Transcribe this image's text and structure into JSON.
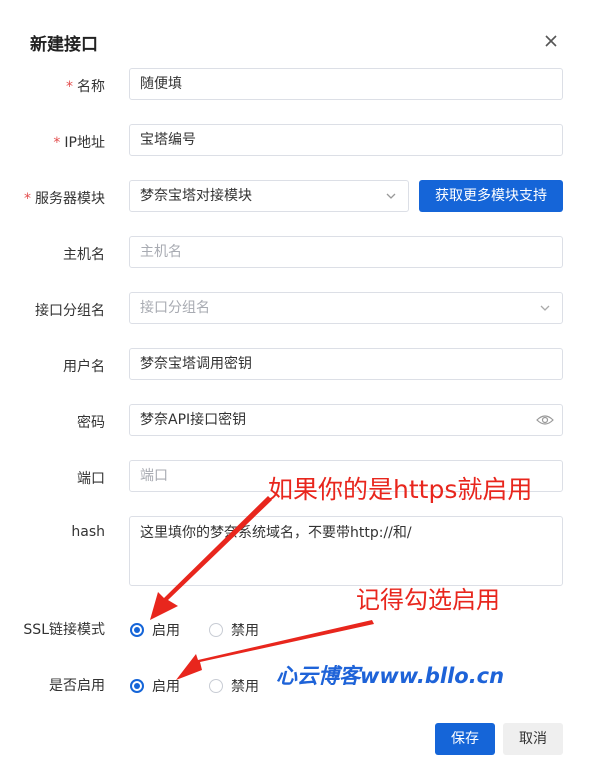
{
  "dialog": {
    "title": "新建接口"
  },
  "fields": {
    "name": {
      "label": "名称",
      "value": "随便填"
    },
    "ip": {
      "label": "IP地址",
      "value": "宝塔编号"
    },
    "module": {
      "label": "服务器模块",
      "value": "梦奈宝塔对接模块",
      "action_label": "获取更多模块支持"
    },
    "host": {
      "label": "主机名",
      "placeholder": "主机名"
    },
    "group": {
      "label": "接口分组名",
      "placeholder": "接口分组名"
    },
    "user": {
      "label": "用户名",
      "value": "梦奈宝塔调用密钥"
    },
    "password": {
      "label": "密码",
      "value": "梦奈API接口密钥"
    },
    "port": {
      "label": "端口",
      "placeholder": "端口"
    },
    "hash": {
      "label": "hash",
      "value": "这里填你的梦奈系统域名，不要带http://和/"
    }
  },
  "ssl": {
    "label": "SSL链接模式",
    "options": [
      "启用",
      "禁用"
    ],
    "selected": "启用"
  },
  "enabled": {
    "label": "是否启用",
    "options": [
      "启用",
      "禁用"
    ],
    "selected": "启用"
  },
  "footer": {
    "save_label": "保存",
    "cancel_label": "取消"
  },
  "annotations": {
    "https_note": "如果你的是https就启用",
    "check_note": "记得勾选启用",
    "watermark": "心云博客www.bllo.cn"
  },
  "colors": {
    "primary": "#1565d8",
    "required": "#e34d4d",
    "annotation": "#e8261d",
    "watermark": "#1e63d8"
  }
}
